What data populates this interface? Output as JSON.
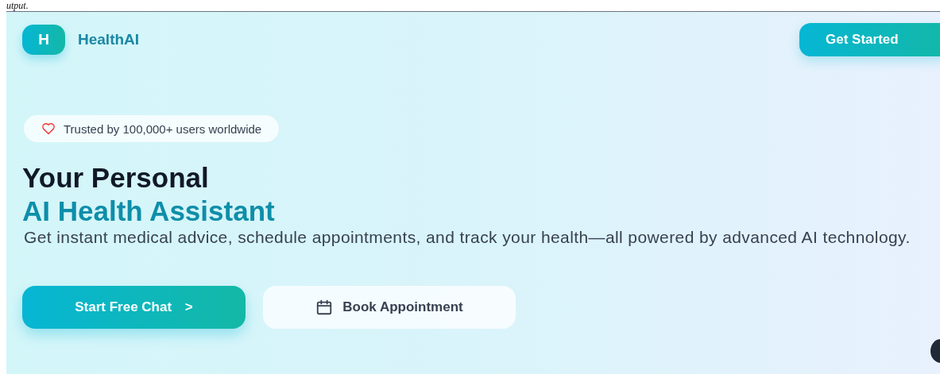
{
  "caption": "utput.",
  "header": {
    "logo_letter": "H",
    "brand": "HealthAI",
    "cta": "Get Started"
  },
  "badge": {
    "text": "Trusted by 100,000+ users worldwide"
  },
  "headline": {
    "line_1": "Your Personal",
    "line_2": "AI Health Assistant"
  },
  "description": "Get instant medical advice, schedule appointments, and track your health—all powered by advanced AI technology.",
  "actions": [
    {
      "kind": "primary",
      "label": "Start Free Chat",
      "trailing": ">"
    },
    {
      "kind": "secondary",
      "label": "Book Appointment"
    }
  ]
}
